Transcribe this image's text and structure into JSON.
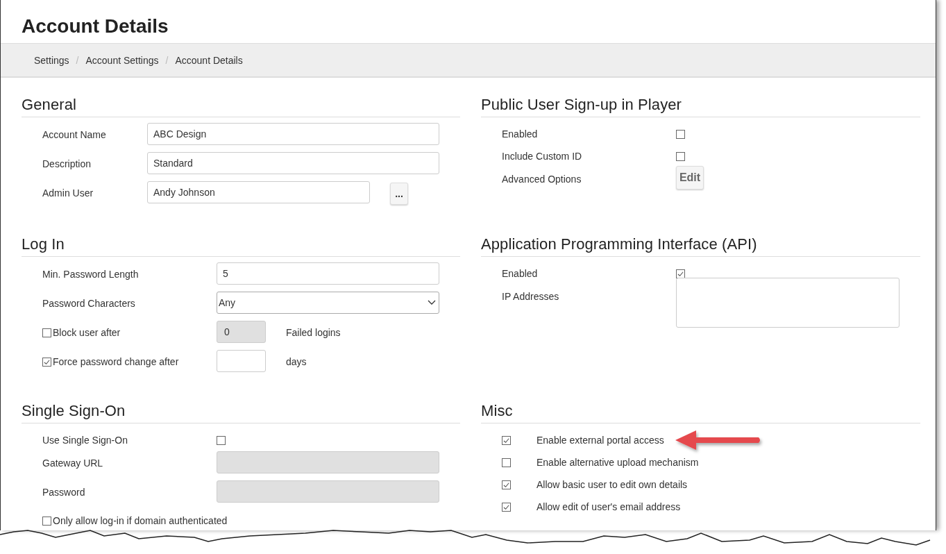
{
  "title": "Account Details",
  "breadcrumbs": [
    {
      "label": "Settings"
    },
    {
      "label": "Account Settings"
    },
    {
      "label": "Account Details"
    }
  ],
  "breadcrumb_separator": "/",
  "columns": [
    [
      {
        "heading": "General",
        "rows": [
          {
            "kind": "text",
            "label": "Account Name",
            "value": "ABC Design",
            "disabled": false
          },
          {
            "kind": "text",
            "label": "Description",
            "value": "Standard",
            "disabled": false
          },
          {
            "kind": "text-more",
            "label": "Admin User",
            "value": "Andy Johnson",
            "button": "..."
          }
        ]
      },
      {
        "heading": "Log In",
        "rows": [
          {
            "kind": "text",
            "label": "Min. Password Length",
            "value": "5",
            "disabled": false
          },
          {
            "kind": "select",
            "label": "Password Characters",
            "value": "Any"
          },
          {
            "kind": "check-number",
            "label": "Block user after",
            "checked": false,
            "value": "0",
            "disabled": true,
            "suffix": "Failed logins"
          },
          {
            "kind": "check-number",
            "label": "Force password change after",
            "checked": true,
            "disabled": false,
            "suffix": "days"
          }
        ]
      },
      {
        "heading": "Single Sign-On",
        "rows": [
          {
            "kind": "checkbox",
            "label": "Use Single Sign-On",
            "checked": false
          },
          {
            "kind": "text",
            "label": "Gateway URL",
            "disabled": true
          },
          {
            "kind": "text",
            "label": "Password",
            "disabled": true
          },
          {
            "kind": "check-label",
            "label": "Only allow log-in if domain authenticated",
            "checked": false
          }
        ]
      }
    ],
    [
      {
        "heading": "Public User Sign-up in Player",
        "rows": [
          {
            "kind": "checkbox",
            "label": "Enabled",
            "checked": false
          },
          {
            "kind": "checkbox",
            "label": "Include Custom ID",
            "checked": false
          },
          {
            "kind": "button",
            "label": "Advanced Options",
            "button": "Edit"
          }
        ]
      },
      {
        "heading": "Application Programming Interface (API)",
        "rows": [
          {
            "kind": "checkbox",
            "label": "Enabled",
            "checked": true
          },
          {
            "kind": "textarea",
            "label": "IP Addresses"
          }
        ]
      },
      {
        "heading": "Misc",
        "rows": [
          {
            "kind": "option",
            "label": "Enable external portal access",
            "checked": true,
            "highlighted": true
          },
          {
            "kind": "option",
            "label": "Enable alternative upload mechanism",
            "checked": false,
            "highlighted": false
          },
          {
            "kind": "option",
            "label": "Allow basic user to edit own details",
            "checked": true,
            "highlighted": false
          },
          {
            "kind": "option",
            "label": "Allow edit of user's email address",
            "checked": true,
            "highlighted": false
          }
        ]
      }
    ]
  ]
}
